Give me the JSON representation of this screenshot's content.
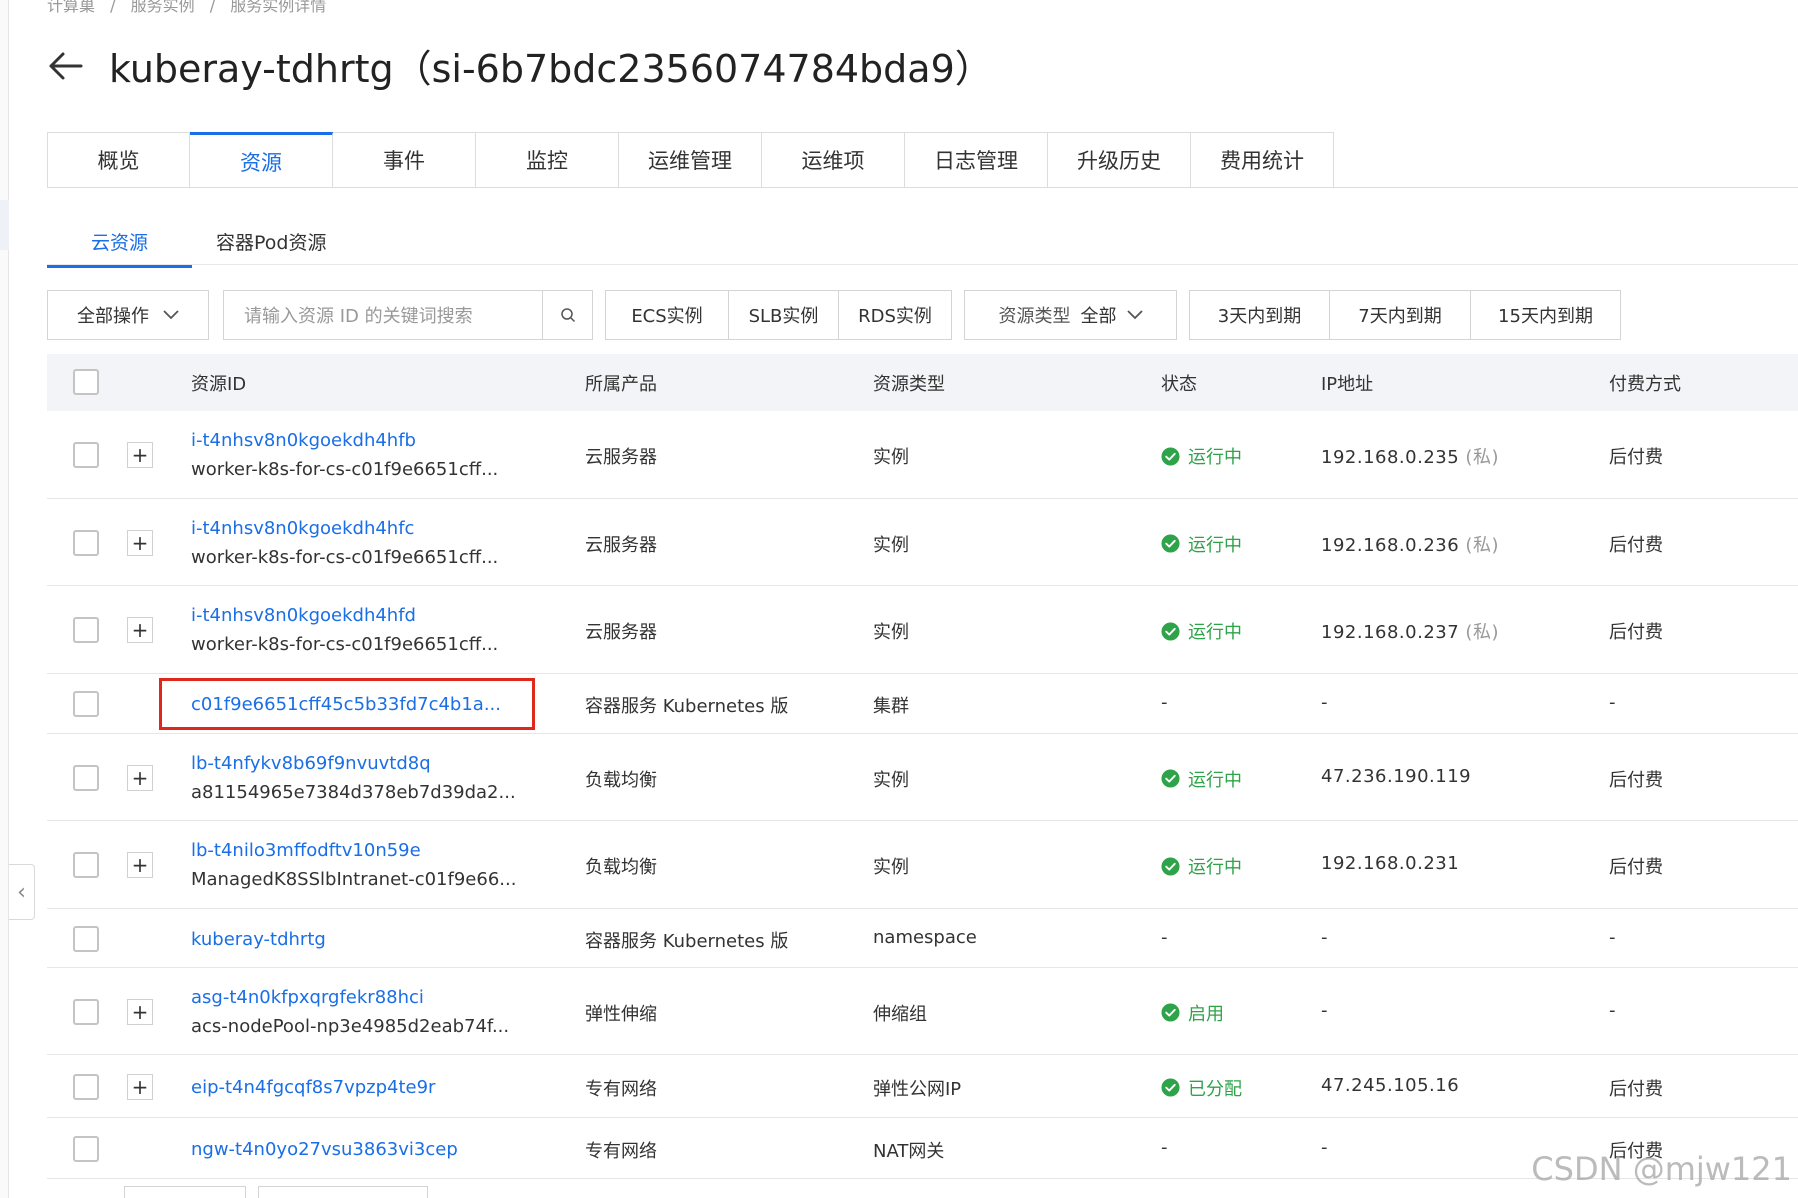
{
  "breadcrumb": [
    "计算巢",
    "/",
    "服务实例",
    "/",
    "服务实例详情"
  ],
  "title": "kuberay-tdhrtg（si-6b7bdc2356074784bda9）",
  "tabs": [
    {
      "label": "概览",
      "active": false
    },
    {
      "label": "资源",
      "active": true
    },
    {
      "label": "事件",
      "active": false
    },
    {
      "label": "监控",
      "active": false
    },
    {
      "label": "运维管理",
      "active": false
    },
    {
      "label": "运维项",
      "active": false
    },
    {
      "label": "日志管理",
      "active": false
    },
    {
      "label": "升级历史",
      "active": false
    },
    {
      "label": "费用统计",
      "active": false
    }
  ],
  "subtabs": [
    {
      "label": "云资源",
      "active": true
    },
    {
      "label": "容器Pod资源",
      "active": false
    }
  ],
  "toolbar": {
    "bulk_label": "全部操作",
    "search_placeholder": "请输入资源 ID 的关键词搜索",
    "filters": [
      "ECS实例",
      "SLB实例",
      "RDS实例"
    ],
    "type_label": "资源类型",
    "type_value": "全部",
    "expire_filters": [
      "3天内到期",
      "7天内到期",
      "15天内到期"
    ]
  },
  "table": {
    "headers": [
      "资源ID",
      "所属产品",
      "资源类型",
      "状态",
      "IP地址",
      "付费方式"
    ],
    "rows": [
      {
        "id": "i-t4nhsv8n0kgoekdh4hfb",
        "sub": "worker-k8s-for-cs-c01f9e6651cff...",
        "expand": true,
        "product": "云服务器",
        "type": "实例",
        "status": "运行中",
        "ip": "192.168.0.235",
        "ip_tag": "(私)",
        "pay": "后付费",
        "highlight": false
      },
      {
        "id": "i-t4nhsv8n0kgoekdh4hfc",
        "sub": "worker-k8s-for-cs-c01f9e6651cff...",
        "expand": true,
        "product": "云服务器",
        "type": "实例",
        "status": "运行中",
        "ip": "192.168.0.236",
        "ip_tag": "(私)",
        "pay": "后付费",
        "highlight": false
      },
      {
        "id": "i-t4nhsv8n0kgoekdh4hfd",
        "sub": "worker-k8s-for-cs-c01f9e6651cff...",
        "expand": true,
        "product": "云服务器",
        "type": "实例",
        "status": "运行中",
        "ip": "192.168.0.237",
        "ip_tag": "(私)",
        "pay": "后付费",
        "highlight": false
      },
      {
        "id": "c01f9e6651cff45c5b33fd7c4b1a...",
        "sub": "",
        "expand": false,
        "product": "容器服务 Kubernetes 版",
        "type": "集群",
        "status": "-",
        "ip": "-",
        "ip_tag": "",
        "pay": "-",
        "highlight": true
      },
      {
        "id": "lb-t4nfykv8b69f9nvuvtd8q",
        "sub": "a81154965e7384d378eb7d39da2...",
        "expand": true,
        "product": "负载均衡",
        "type": "实例",
        "status": "运行中",
        "ip": "47.236.190.119",
        "ip_tag": "",
        "pay": "后付费",
        "highlight": false
      },
      {
        "id": "lb-t4nilo3mffodftv10n59e",
        "sub": "ManagedK8SSlbIntranet-c01f9e66...",
        "expand": true,
        "product": "负载均衡",
        "type": "实例",
        "status": "运行中",
        "ip": "192.168.0.231",
        "ip_tag": "",
        "pay": "后付费",
        "highlight": false
      },
      {
        "id": "kuberay-tdhrtg",
        "sub": "",
        "expand": false,
        "product": "容器服务 Kubernetes 版",
        "type": "namespace",
        "status": "-",
        "ip": "-",
        "ip_tag": "",
        "pay": "-",
        "highlight": false
      },
      {
        "id": "asg-t4n0kfpxqrgfekr88hci",
        "sub": "acs-nodePool-np3e4985d2eab74f...",
        "expand": true,
        "product": "弹性伸缩",
        "type": "伸缩组",
        "status": "启用",
        "ip": "-",
        "ip_tag": "",
        "pay": "-",
        "highlight": false
      },
      {
        "id": "eip-t4n4fgcqf8s7vpzp4te9r",
        "sub": "",
        "expand": true,
        "product": "专有网络",
        "type": "弹性公网IP",
        "status": "已分配",
        "ip": "47.245.105.16",
        "ip_tag": "",
        "pay": "后付费",
        "highlight": false
      },
      {
        "id": "ngw-t4n0yo27vsu3863vi3cep",
        "sub": "",
        "expand": false,
        "product": "专有网络",
        "type": "NAT网关",
        "status": "-",
        "ip": "-",
        "ip_tag": "",
        "pay": "后付费",
        "highlight": false
      }
    ]
  },
  "watermark": "CSDN @mjw121",
  "colors": {
    "accent": "#1a6ee6",
    "success": "#2fa34a",
    "highlight": "#e0271b"
  }
}
